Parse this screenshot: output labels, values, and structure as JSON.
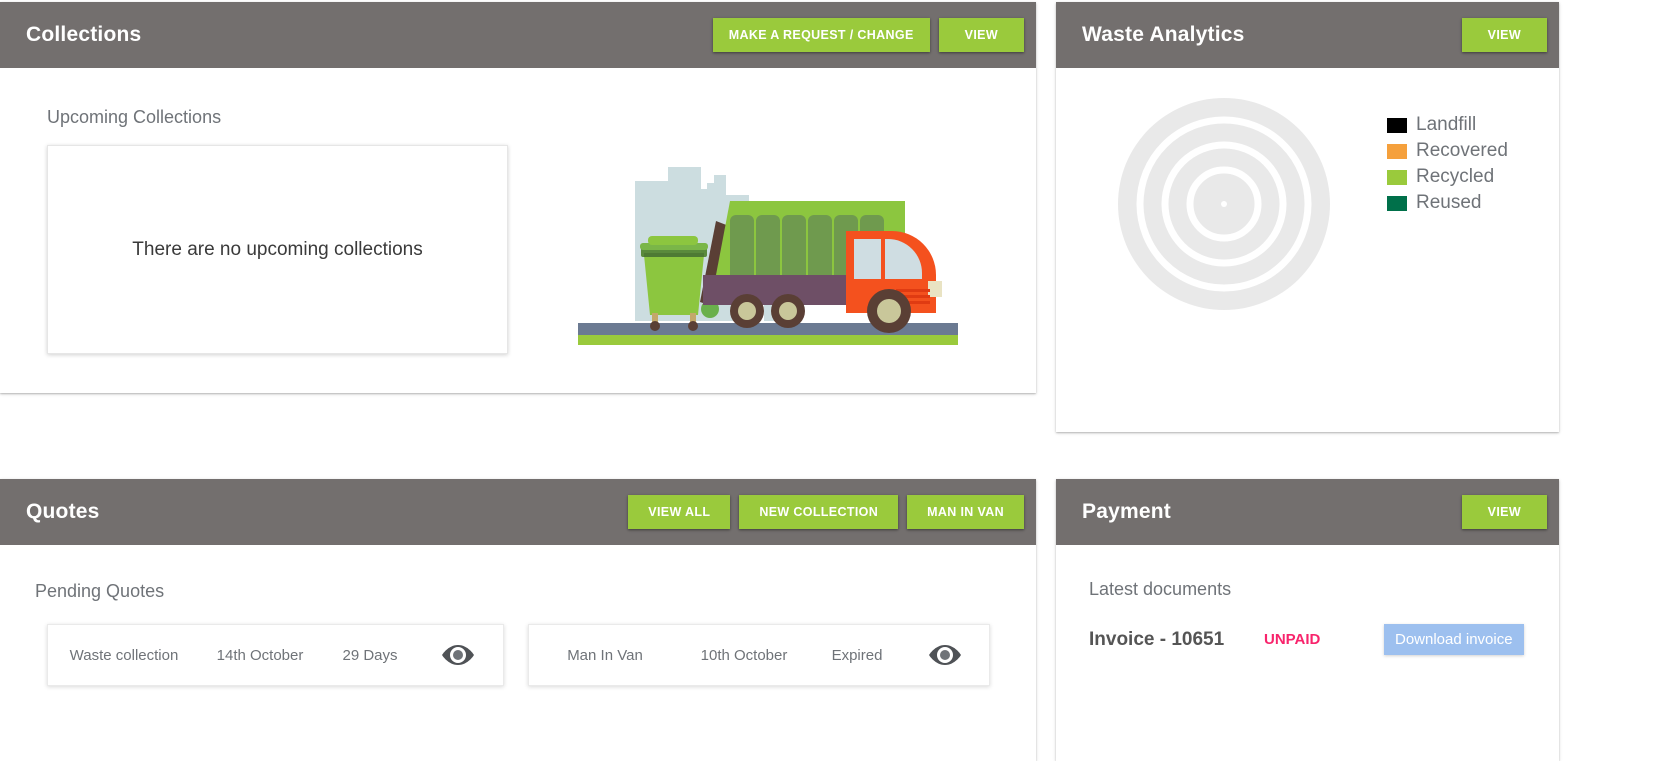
{
  "collections": {
    "title": "Collections",
    "buttons": [
      {
        "label": "MAKE A REQUEST / CHANGE",
        "name": "make-a-request-change-button"
      },
      {
        "label": "VIEW",
        "name": "view-button"
      }
    ],
    "section_label": "Upcoming Collections",
    "empty_message": "There are no upcoming collections",
    "illustration": "garbage-truck-illustration"
  },
  "analytics": {
    "title": "Waste Analytics",
    "view_label": "VIEW",
    "chart_placeholder": "target-rings-placeholder",
    "legend": [
      {
        "label": "Landfill",
        "color": "#000000"
      },
      {
        "label": "Recovered",
        "color": "#f5a03c"
      },
      {
        "label": "Recycled",
        "color": "#9aca3c"
      },
      {
        "label": "Reused",
        "color": "#00704a"
      }
    ]
  },
  "chart_data": {
    "type": "pie",
    "title": "Waste Analytics",
    "categories": [
      "Landfill",
      "Recovered",
      "Recycled",
      "Reused"
    ],
    "values": [
      0,
      0,
      0,
      0
    ],
    "colors": [
      "#000000",
      "#f5a03c",
      "#9aca3c",
      "#00704a"
    ],
    "legend_position": "right",
    "grid": false,
    "note": "no data plotted - empty concentric ring placeholder shown"
  },
  "quotes": {
    "title": "Quotes",
    "buttons": [
      {
        "label": "VIEW ALL",
        "name": "view-all-button"
      },
      {
        "label": "NEW COLLECTION",
        "name": "new-collection-button"
      },
      {
        "label": "MAN IN VAN",
        "name": "man-in-van-button"
      }
    ],
    "section_label": "Pending Quotes",
    "items": [
      {
        "service": "Waste collection",
        "date": "14th October",
        "status": "29 Days",
        "action_icon": "eye-icon"
      },
      {
        "service": "Man In Van",
        "date": "10th October",
        "status": "Expired",
        "action_icon": "eye-icon"
      }
    ]
  },
  "payment": {
    "title": "Payment",
    "view_label": "VIEW",
    "section_label": "Latest documents",
    "documents": [
      {
        "name": "Invoice - 10651",
        "status": "UNPAID",
        "action_label": "Download invoice"
      }
    ]
  },
  "colors": {
    "header_gray": "#736f6e",
    "accent_green": "#9aca3c",
    "unpaid_pink": "#f8246c",
    "download_blue": "#9dc0ef",
    "label_gray": "#6f7378"
  }
}
